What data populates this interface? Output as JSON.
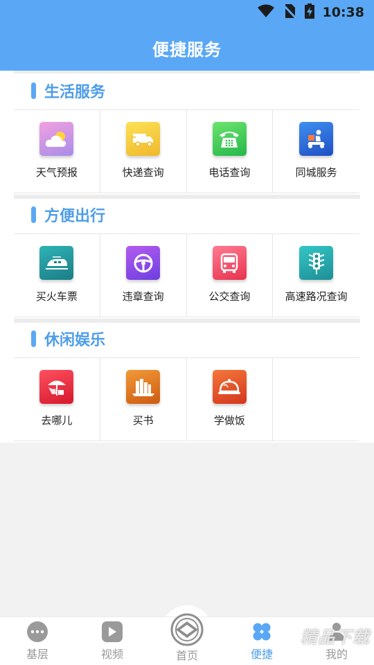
{
  "status_bar": {
    "time": "10:38",
    "icons": [
      "wifi-icon",
      "no-sim-icon",
      "battery-charging-icon"
    ]
  },
  "header": {
    "title": "便捷服务"
  },
  "sections": [
    {
      "title": "生活服务",
      "items": [
        {
          "label": "天气预报",
          "icon": "weather-icon",
          "color": "#c78ee6"
        },
        {
          "label": "快递查询",
          "icon": "delivery-truck-icon",
          "color": "#f5c83a"
        },
        {
          "label": "电话查询",
          "icon": "telephone-icon",
          "color": "#3cc755"
        },
        {
          "label": "同城服务",
          "icon": "scooter-courier-icon",
          "color": "#2d6edb"
        }
      ]
    },
    {
      "title": "方便出行",
      "items": [
        {
          "label": "买火车票",
          "icon": "train-icon",
          "color": "#259aa0"
        },
        {
          "label": "违章查询",
          "icon": "steering-wheel-icon",
          "color": "#8a4ee8"
        },
        {
          "label": "公交查询",
          "icon": "bus-icon",
          "color": "#f04a64"
        },
        {
          "label": "高速路况查询",
          "icon": "traffic-light-icon",
          "color": "#27aaae"
        }
      ]
    },
    {
      "title": "休闲娱乐",
      "items": [
        {
          "label": "去哪儿",
          "icon": "beach-umbrella-icon",
          "color": "#e8283a"
        },
        {
          "label": "买书",
          "icon": "books-icon",
          "color": "#e07a24"
        },
        {
          "label": "学做饭",
          "icon": "food-cloche-icon",
          "color": "#e45428"
        }
      ]
    }
  ],
  "tabbar": {
    "tabs": [
      {
        "label": "基层",
        "icon": "more-dots-icon"
      },
      {
        "label": "视频",
        "icon": "play-icon"
      },
      {
        "label": "首页",
        "icon": "home-logo-icon"
      },
      {
        "label": "便捷",
        "icon": "clover-icon",
        "active": true
      },
      {
        "label": "我的",
        "icon": "user-icon"
      }
    ],
    "active_color": "#4d9de8",
    "inactive_color": "#999999"
  },
  "watermark": {
    "text": "精品下载"
  }
}
